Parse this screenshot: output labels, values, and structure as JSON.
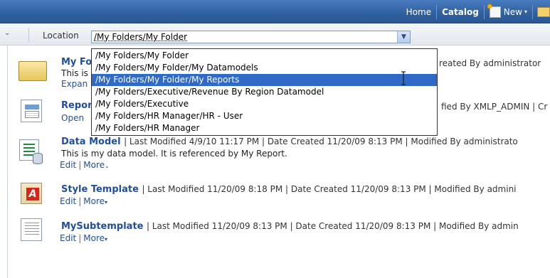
{
  "header": {
    "home": "Home",
    "catalog": "Catalog",
    "new": "New",
    "new_caret": "▾"
  },
  "location": {
    "collapse_glyph": "⌄",
    "label": "Location",
    "value": "/My Folders/My Folder",
    "arrow": "▼"
  },
  "dropdown": {
    "options": [
      "/My Folders/My Folder",
      "/My Folders/My Folder/My Datamodels",
      "/My Folders/My Folder/My Reports",
      "/My Folders/Executive/Revenue By Region Datamodel",
      "/My Folders/Executive",
      "/My Folders/HR Manager/HR - User",
      "/My Folders/HR Manager"
    ],
    "selected_index": 2
  },
  "items": [
    {
      "title_visible": "My Fo",
      "desc_visible": "This is",
      "action_visible": "Expan",
      "right_meta": "reated By administrator"
    },
    {
      "title_visible": "Repor",
      "action_visible": "Open",
      "right_meta": "fied By XMLP_ADMIN | Cr"
    },
    {
      "title": "Data Model",
      "meta": "| Last Modified 4/9/10 11:17 PM | Date Created 11/20/09 8:13 PM | Modified By administrato",
      "desc": "This is my data model. It is referenced by My Report.",
      "edit": "Edit",
      "more": "More",
      "more_caret": "⌄"
    },
    {
      "title": "Style Template",
      "meta": "| Last Modified 11/20/09 8:18 PM | Date Created 11/20/09 8:13 PM | Modified By admini",
      "edit": "Edit",
      "more": "More",
      "more_caret": "▾"
    },
    {
      "title": "MySubtemplate",
      "meta": "| Last Modified 11/20/09 8:13 PM | Date Created 11/20/09 8:13 PM | Modified By admin",
      "edit": "Edit",
      "more": "More",
      "more_caret": "▾"
    }
  ],
  "icons": {
    "style_template_letter": "A"
  },
  "colors": {
    "header_blue": "#2f5f9f",
    "link_blue": "#1f4f9c",
    "selected_option": "#3169c6"
  }
}
